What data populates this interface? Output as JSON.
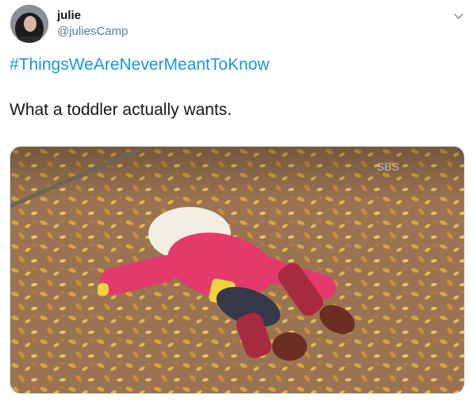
{
  "tweet": {
    "author": {
      "display_name": "julie",
      "handle": "@juliesCamp"
    },
    "hashtag": "#ThingsWeAreNeverMeantToKnow",
    "text": "What a toddler actually wants.",
    "menu_icon": "chevron-down-icon",
    "media": {
      "watermark": "SBS"
    }
  },
  "colors": {
    "link": "#1b95e0",
    "text": "#14171a",
    "secondary": "#657786"
  }
}
